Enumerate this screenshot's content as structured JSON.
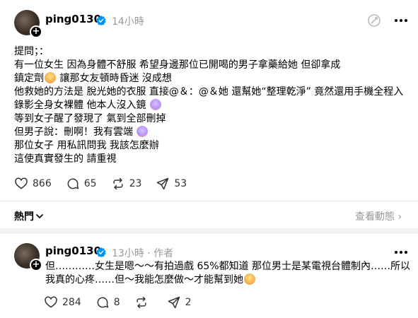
{
  "posts": [
    {
      "handle": "ping0130",
      "time": "14小時",
      "lines": [
        "提問；：",
        "有一位女生 因為身體不舒服 希望身邊那位已開喝的男子拿藥給她 但卻拿成",
        "鎮定劑",
        " 讓那女友頓時昏迷 沒成想",
        "他救她的方法是 脫光她的衣服 直接@＆：@＆她 還幫她“整理乾淨” 竟然還用手機全程入",
        "錄影全身女裸體 他本人沒入鏡",
        "等到女子醒了發現了 氣到全部刪掉",
        "但男子說：刪啊！我有雲端",
        "那位女子 用私訊問我 我該怎麼辦",
        "這使真實發生的 請重視"
      ],
      "stats": {
        "likes": "866",
        "comments": "65",
        "reposts": "23",
        "shares": "53"
      }
    },
    {
      "handle": "ping0130",
      "time": "13小時",
      "author_tag": "作者",
      "lines": [
        "但…………女生是嗯～～有拍過戲 65%都知道 那位男士是某電視台體制內……所以",
        "我真的心疼……但～我能怎麼做～才能幫到她"
      ],
      "stats": {
        "likes": "284",
        "comments": "8",
        "reposts": "",
        "shares": "2"
      }
    }
  ],
  "section": {
    "title": "熱門",
    "activity": "查看動態"
  },
  "icons": {
    "verified": "verified-badge-icon",
    "more": "more-horizontal-icon",
    "translate": "translate-icon"
  },
  "colors": {
    "verified": "#0095f6",
    "muted": "#999999",
    "text": "#000000"
  }
}
